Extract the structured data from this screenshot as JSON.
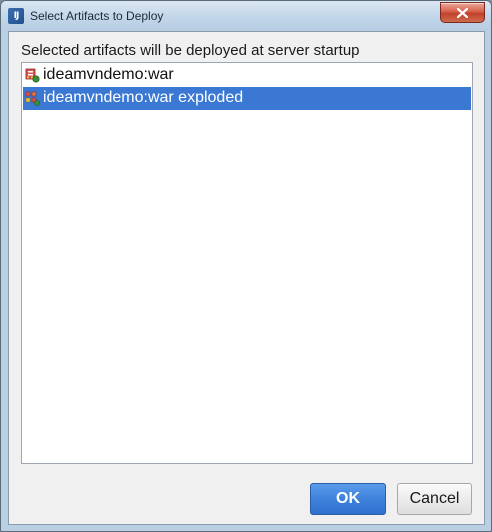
{
  "window": {
    "title": "Select Artifacts to Deploy",
    "app_icon_glyph": "IJ"
  },
  "dialog": {
    "heading": "Selected artifacts will be deployed at server startup",
    "artifacts": [
      {
        "label": "ideamvndemo:war",
        "icon": "war-archive-icon",
        "selected": false
      },
      {
        "label": "ideamvndemo:war exploded",
        "icon": "war-exploded-icon",
        "selected": true
      }
    ],
    "ok_label": "OK",
    "cancel_label": "Cancel"
  },
  "colors": {
    "selection": "#3a78d4",
    "ok_button": "#3f82dc",
    "close_button": "#c0412b"
  }
}
